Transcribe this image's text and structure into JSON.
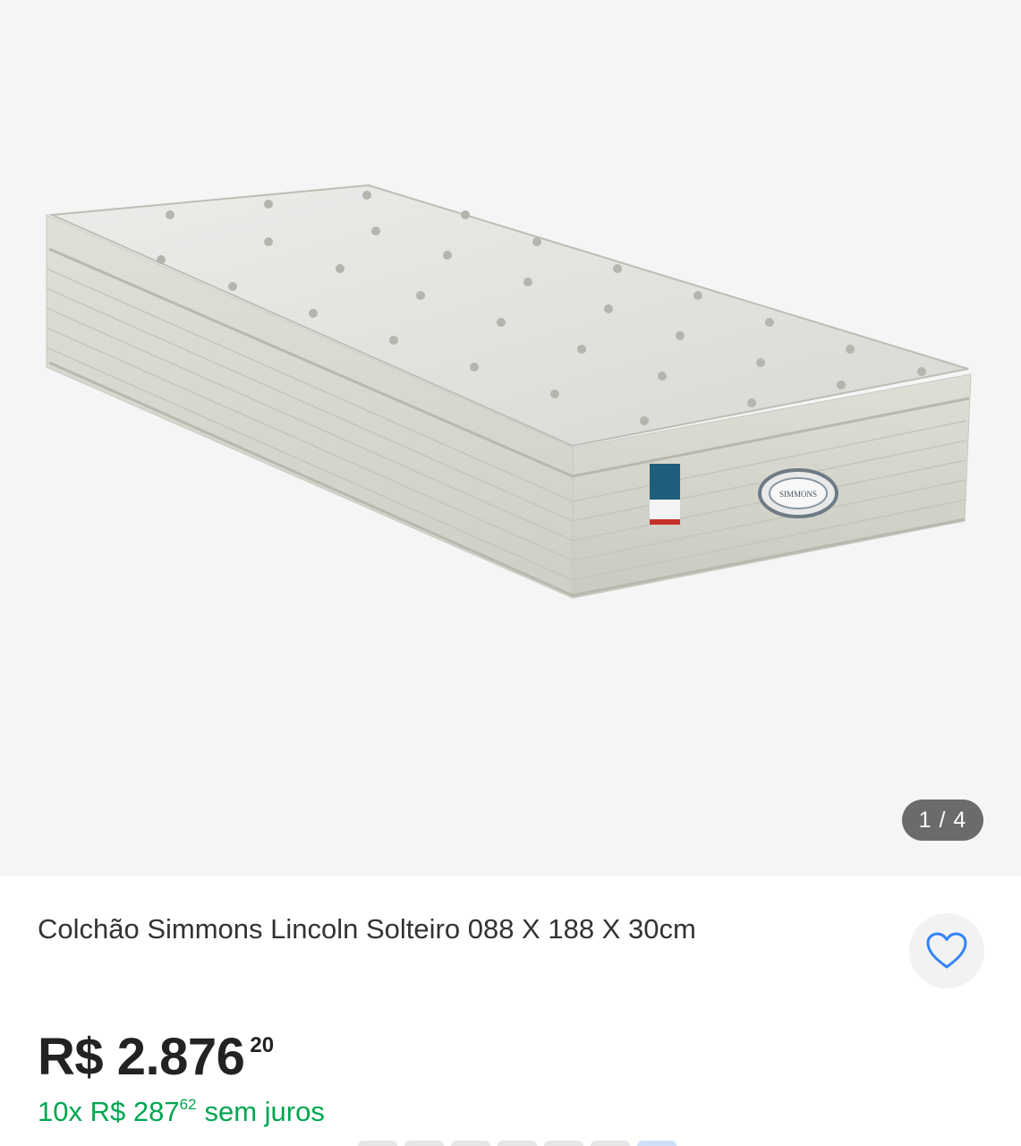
{
  "gallery": {
    "image_alt": "mattress-photo",
    "counter": "1 / 4",
    "brand_label": "SIMMONS"
  },
  "product": {
    "title": "Colchão Simmons Lincoln Solteiro 088 X 188 X 30cm",
    "price": {
      "main": "R$ 2.876",
      "cents": "20"
    },
    "installments": {
      "prefix": "10x R$ 287",
      "cents": "62",
      "suffix": "sem juros"
    }
  },
  "colors": {
    "accent_green": "#00a650",
    "heart_blue": "#3483fa",
    "counter_bg": "#6b6b6b"
  },
  "icons": {
    "favorite": "heart-outline-icon"
  }
}
